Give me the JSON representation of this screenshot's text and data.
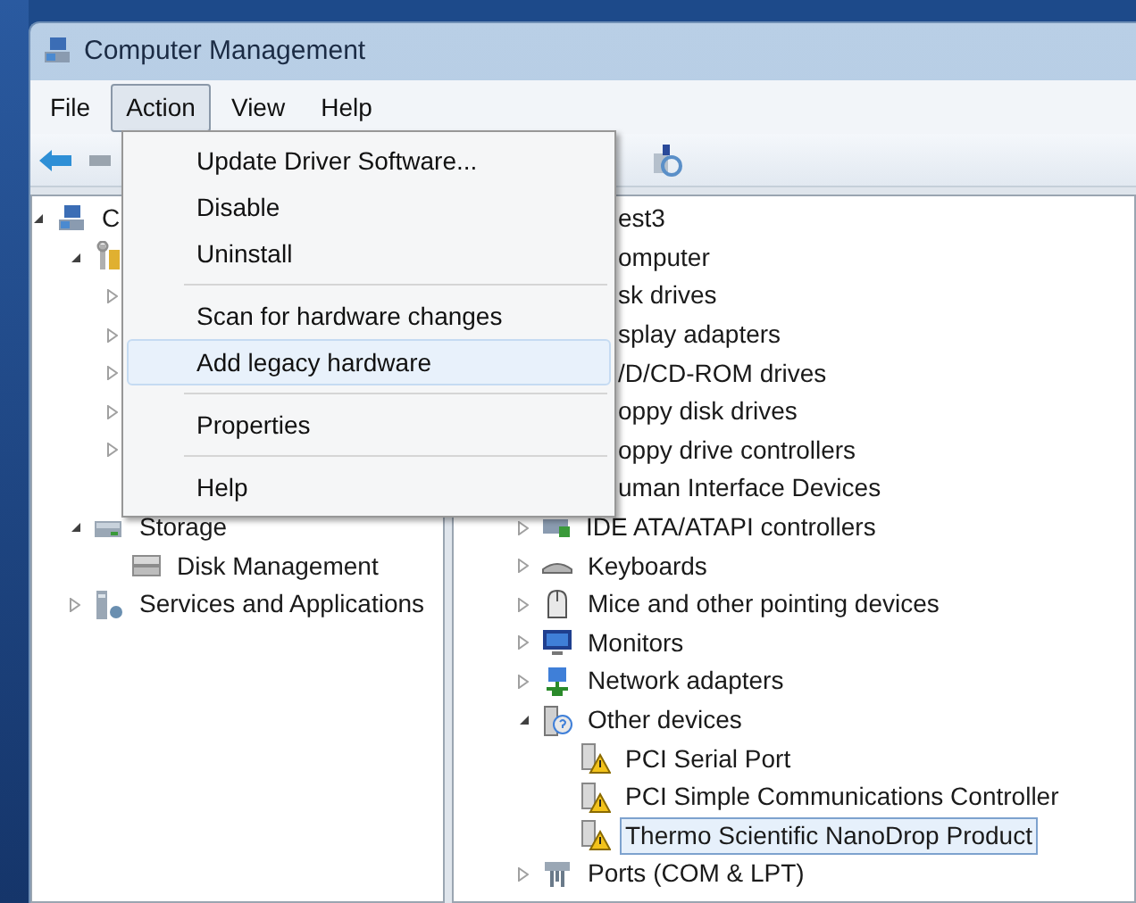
{
  "window": {
    "title": "Computer Management"
  },
  "menu_bar": [
    {
      "label": "File",
      "selected": false
    },
    {
      "label": "Action",
      "selected": true
    },
    {
      "label": "View",
      "selected": false
    },
    {
      "label": "Help",
      "selected": false
    }
  ],
  "action_menu": [
    {
      "kind": "item",
      "label": "Update Driver Software...",
      "highlighted": false
    },
    {
      "kind": "item",
      "label": "Disable",
      "highlighted": false
    },
    {
      "kind": "item",
      "label": "Uninstall",
      "highlighted": false
    },
    {
      "kind": "separator"
    },
    {
      "kind": "item",
      "label": "Scan for hardware changes",
      "highlighted": false
    },
    {
      "kind": "item",
      "label": "Add legacy hardware",
      "highlighted": true
    },
    {
      "kind": "separator"
    },
    {
      "kind": "item",
      "label": "Properties",
      "highlighted": false
    },
    {
      "kind": "separator"
    },
    {
      "kind": "item",
      "label": "Help",
      "highlighted": false
    }
  ],
  "left_tree": [
    {
      "label": "C",
      "kind": "computer",
      "expanded": true,
      "children": [
        {
          "kind": "tools",
          "expanded": true,
          "children": [
            {
              "kind": "hidden",
              "expanded": false
            },
            {
              "kind": "hidden",
              "expanded": false
            },
            {
              "kind": "hidden",
              "expanded": false
            },
            {
              "kind": "hidden",
              "expanded": false
            },
            {
              "kind": "hidden",
              "expanded": false
            },
            {
              "kind": "hidden"
            }
          ]
        },
        {
          "label": "Storage",
          "kind": "storage",
          "expanded": true,
          "children": [
            {
              "label": "Disk Management",
              "kind": "disk"
            }
          ]
        },
        {
          "label": "Services and Applications",
          "kind": "services",
          "expanded": false
        }
      ]
    }
  ],
  "right_tree": [
    {
      "label": "est3",
      "kind": "covered",
      "selected": false,
      "children": [
        {
          "label": "omputer",
          "kind": "covered",
          "selected": false
        },
        {
          "label": "sk drives",
          "kind": "covered",
          "selected": false
        },
        {
          "label": "splay adapters",
          "kind": "covered",
          "selected": false
        },
        {
          "label": "/D/CD-ROM drives",
          "kind": "covered",
          "selected": false
        },
        {
          "label": "oppy disk drives",
          "kind": "covered",
          "selected": false
        },
        {
          "label": "oppy drive controllers",
          "kind": "covered",
          "selected": false
        },
        {
          "label": "uman Interface Devices",
          "kind": "covered",
          "selected": false
        },
        {
          "label": "IDE ATA/ATAPI controllers",
          "kind": "controller",
          "selected": false,
          "expanded": false
        },
        {
          "label": "Keyboards",
          "kind": "keyboard",
          "selected": false,
          "expanded": false
        },
        {
          "label": "Mice and other pointing devices",
          "kind": "mouse",
          "selected": false,
          "expanded": false
        },
        {
          "label": "Monitors",
          "kind": "monitor",
          "selected": false,
          "expanded": false
        },
        {
          "label": "Network adapters",
          "kind": "network",
          "selected": false,
          "expanded": false
        },
        {
          "label": "Other devices",
          "kind": "unknown",
          "selected": false,
          "expanded": true,
          "children": [
            {
              "label": "PCI Serial Port",
              "kind": "warning",
              "selected": false
            },
            {
              "label": "PCI Simple Communications Controller",
              "kind": "warning",
              "selected": false
            },
            {
              "label": "Thermo Scientific NanoDrop Product",
              "kind": "warning",
              "selected": true
            }
          ]
        },
        {
          "label": "Ports (COM & LPT)",
          "kind": "port",
          "selected": false,
          "expanded": false
        }
      ]
    }
  ]
}
